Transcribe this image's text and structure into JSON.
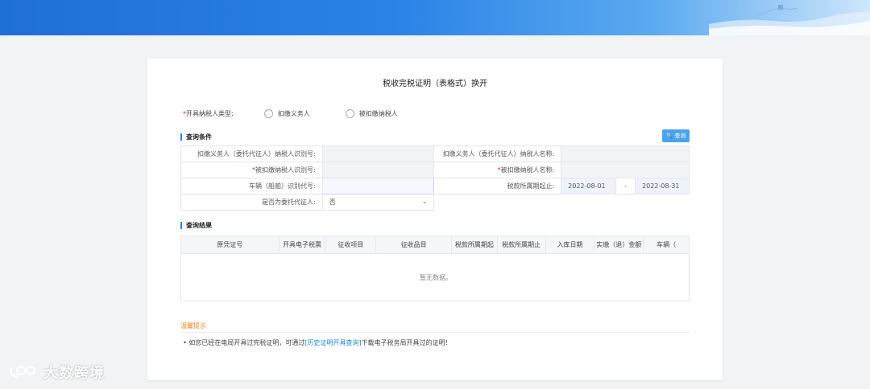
{
  "page": {
    "title": "税收完税证明（表格式）换开"
  },
  "taxpayer_type": {
    "label": "开具纳税人类型:",
    "required_mark": "*",
    "options": [
      "扣缴义务人",
      "被扣缴纳税人"
    ]
  },
  "query": {
    "section_title": "查询条件",
    "button_label": "查询",
    "fields": {
      "withholder_id_label": "扣缴义务人（委托代征人）纳税人识别号:",
      "withholder_name_label": "扣缴义务人（委托代征人）纳税人名称:",
      "withheld_id_label": "被扣缴纳税人识别号:",
      "withheld_name_label": "被扣缴纳税人名称:",
      "vehicle_id_label": "车辆（船舶）识别代号:",
      "tax_period_label": "税款所属期起止:",
      "period_start": "2022-08-01",
      "period_sep": "-",
      "period_end": "2022-08-31",
      "entrusted_label": "是否为委托代征人:",
      "entrusted_value": "否"
    }
  },
  "results": {
    "section_title": "查询结果",
    "columns": [
      "原凭证号",
      "开具电子税票",
      "征收项目",
      "征收品目",
      "税款所属期起",
      "税款所属期止",
      "入库日期",
      "实缴（退）金额",
      "车辆（"
    ],
    "empty_text": "暂无数据。"
  },
  "tips": {
    "title": "温馨提示",
    "bullet": "•",
    "text_before": "如您已经在电局开具过完税证明，可通过",
    "link_text": "[历史证明开具查询]",
    "text_after": "下载电子税务局开具过的证明！"
  },
  "watermark": {
    "text": "大数跨境"
  }
}
